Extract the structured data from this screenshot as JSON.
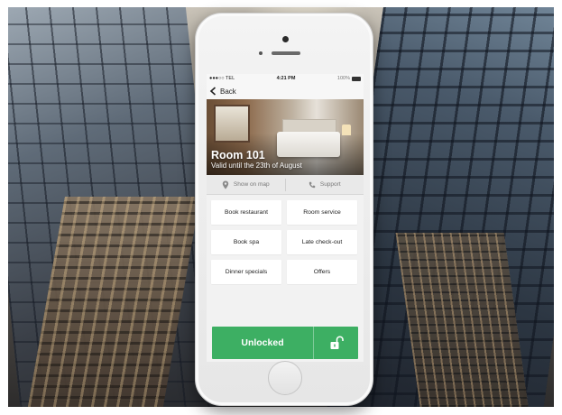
{
  "status_bar": {
    "carrier": "●●●○○ TEL",
    "time": "4:21 PM",
    "battery": "100%"
  },
  "nav": {
    "back_label": "Back"
  },
  "room": {
    "title": "Room 101",
    "subtitle": "Valid until the 23th of August"
  },
  "actions": [
    {
      "label": "Show on map",
      "icon": "map-pin-icon"
    },
    {
      "label": "Support",
      "icon": "phone-icon"
    }
  ],
  "services": [
    {
      "label": "Book restaurant"
    },
    {
      "label": "Room service"
    },
    {
      "label": "Book spa"
    },
    {
      "label": "Late check-out"
    },
    {
      "label": "Dinner specials"
    },
    {
      "label": "Offers"
    }
  ],
  "unlock": {
    "label": "Unlocked",
    "icon": "unlocked-padlock-icon",
    "color": "#3daf63"
  }
}
